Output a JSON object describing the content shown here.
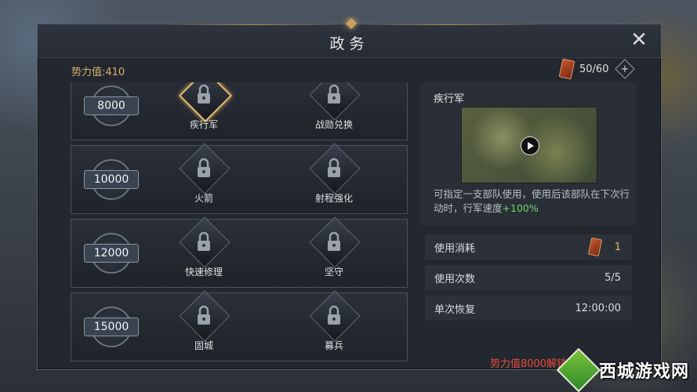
{
  "window": {
    "title": "政务",
    "close_label": "✕"
  },
  "power": {
    "label": "势力值:410"
  },
  "tokens": {
    "count": "50/60",
    "add_label": "+"
  },
  "rows": [
    {
      "cost": "8000",
      "skills": [
        {
          "name": "疾行军",
          "icon": "lock-icon",
          "selected": true
        },
        {
          "name": "战勋兑换",
          "icon": "lock-icon",
          "selected": false
        }
      ]
    },
    {
      "cost": "10000",
      "skills": [
        {
          "name": "火箭",
          "icon": "lock-icon",
          "selected": false
        },
        {
          "name": "射程强化",
          "icon": "lock-icon",
          "selected": false
        }
      ]
    },
    {
      "cost": "12000",
      "skills": [
        {
          "name": "快速修理",
          "icon": "lock-icon",
          "selected": false
        },
        {
          "name": "坚守",
          "icon": "lock-icon",
          "selected": false
        }
      ]
    },
    {
      "cost": "15000",
      "skills": [
        {
          "name": "固城",
          "icon": "lock-icon",
          "selected": false
        },
        {
          "name": "募兵",
          "icon": "lock-icon",
          "selected": false
        }
      ]
    }
  ],
  "detail": {
    "name": "疾行军",
    "desc_main": "可指定一支部队使用，使用后该部队在下次行动时，行军速度",
    "desc_highlight": "+100%",
    "stats": [
      {
        "label": "使用消耗",
        "value": "1"
      },
      {
        "label": "使用次数",
        "value": "5/5"
      },
      {
        "label": "单次恢复",
        "value": "12:00:00"
      }
    ],
    "unlock_text": "势力值8000解锁"
  },
  "watermark": {
    "text": "西城游戏网"
  },
  "colors": {
    "accent": "#d8b26c",
    "highlight": "#6ed86a",
    "warning": "#e84a3a"
  }
}
